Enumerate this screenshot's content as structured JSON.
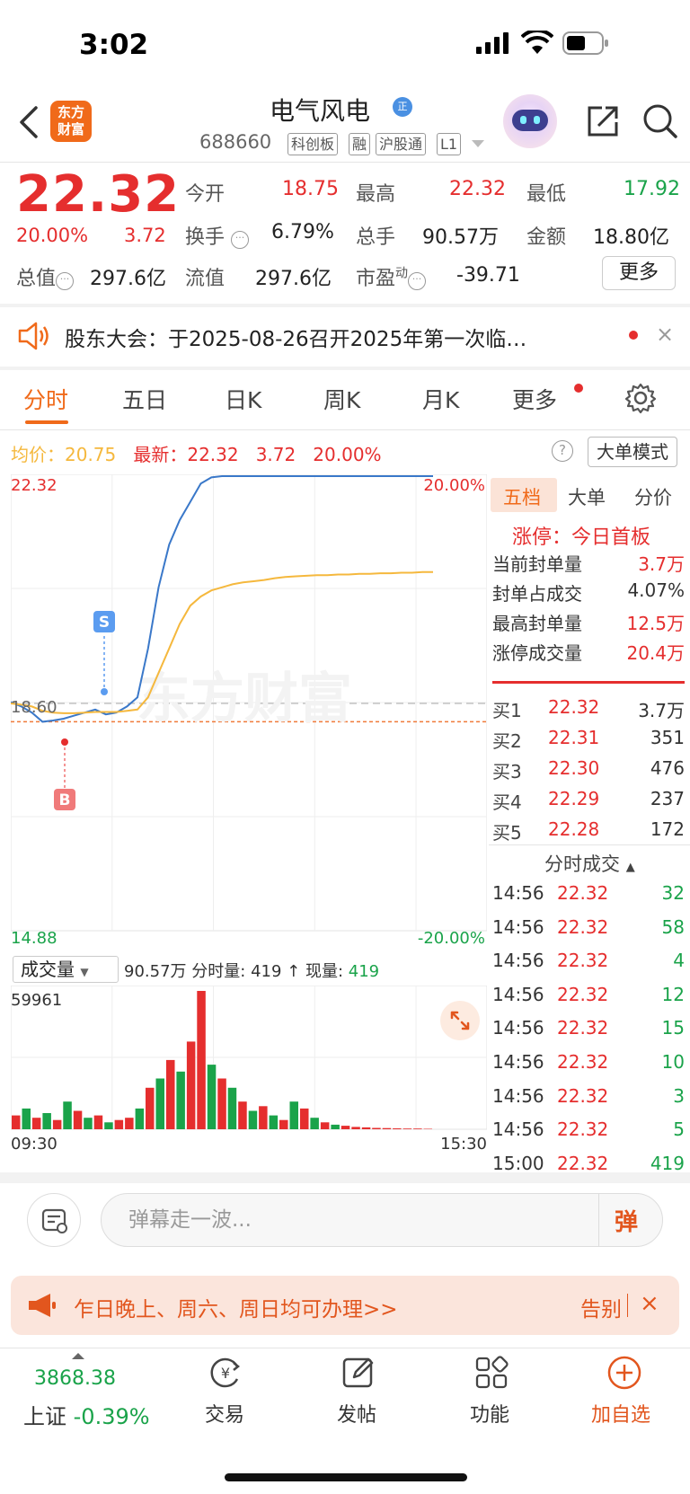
{
  "status": {
    "time": "3:02"
  },
  "header": {
    "logo": "东方\n财富",
    "name": "电气风电",
    "name_badge": "正",
    "code": "688660",
    "tags": [
      "科创板",
      "融",
      "沪股通",
      "L1"
    ]
  },
  "quote": {
    "price": "22.32",
    "pct": "20.00%",
    "chg": "3.72",
    "open_label": "今开",
    "open": "18.75",
    "high_label": "最高",
    "high": "22.32",
    "low_label": "最低",
    "low": "17.92",
    "turnover_label": "换手",
    "turnover": "6.79%",
    "volume_label": "总手",
    "volume": "90.57万",
    "amount_label": "金额",
    "amount": "18.80亿",
    "mktcap_label": "总值",
    "mktcap": "297.6亿",
    "float_label": "流值",
    "float": "297.6亿",
    "pe_label": "市盈",
    "pe_sup": "动",
    "pe": "-39.71",
    "more": "更多"
  },
  "notice": {
    "text": "股东大会：于2025-08-26召开2025年第一次临…",
    "close": "×"
  },
  "tabs": [
    "分时",
    "五日",
    "日K",
    "周K",
    "月K",
    "更多"
  ],
  "chart_header": {
    "avg_label": "均价：",
    "avg": "20.75",
    "latest_label": "最新：",
    "latest": "22.32",
    "chg": "3.72",
    "pct": "20.00%",
    "help": "?",
    "big_order": "大单模式"
  },
  "chart_labels": {
    "top_price": "22.32",
    "top_pct": "20.00%",
    "mid_price": "18.60",
    "bottom_price": "14.88",
    "bottom_pct": "-20.00%",
    "marker_s": "S",
    "marker_b": "B",
    "watermark": "东方财富"
  },
  "chart_data": {
    "type": "line",
    "ylim": [
      14.88,
      22.32
    ],
    "prev_close": 18.6,
    "series": [
      {
        "name": "price",
        "values": [
          18.62,
          18.55,
          18.45,
          18.3,
          18.32,
          18.35,
          18.4,
          18.45,
          18.5,
          18.42,
          18.45,
          18.55,
          18.7,
          19.5,
          20.5,
          21.2,
          21.6,
          21.9,
          22.2,
          22.3,
          22.32,
          22.32,
          22.32,
          22.32,
          22.32,
          22.32,
          22.32,
          22.32,
          22.32,
          22.32,
          22.32,
          22.32,
          22.32,
          22.32,
          22.32,
          22.32,
          22.32,
          22.32,
          22.32,
          22.32,
          22.32
        ]
      },
      {
        "name": "avg",
        "values": [
          18.6,
          18.58,
          18.55,
          18.48,
          18.45,
          18.44,
          18.44,
          18.45,
          18.46,
          18.46,
          18.46,
          18.48,
          18.5,
          18.7,
          19.1,
          19.5,
          19.9,
          20.2,
          20.35,
          20.45,
          20.5,
          20.55,
          20.58,
          20.6,
          20.62,
          20.65,
          20.67,
          20.68,
          20.69,
          20.7,
          20.7,
          20.71,
          20.71,
          20.72,
          20.72,
          20.73,
          20.73,
          20.74,
          20.74,
          20.75,
          20.75
        ]
      }
    ],
    "volume": {
      "max": 59961,
      "values": [
        6000,
        9000,
        5000,
        7000,
        4000,
        12000,
        8000,
        5000,
        6000,
        3000,
        4000,
        5000,
        9000,
        18000,
        22000,
        30000,
        25000,
        38000,
        59961,
        28000,
        22000,
        18000,
        12000,
        8000,
        10000,
        6000,
        4000,
        12000,
        9000,
        5000,
        3000,
        2000,
        1500,
        1000,
        800,
        600,
        500,
        400,
        300,
        300,
        200
      ],
      "colors": [
        "r",
        "g",
        "r",
        "g",
        "r",
        "g",
        "r",
        "g",
        "r",
        "g",
        "r",
        "r",
        "g",
        "r",
        "g",
        "r",
        "g",
        "r",
        "r",
        "g",
        "r",
        "g",
        "r",
        "g",
        "r",
        "g",
        "r",
        "g",
        "r",
        "g",
        "r",
        "g",
        "r",
        "r",
        "r",
        "r",
        "r",
        "r",
        "r",
        "r",
        "r"
      ]
    },
    "x_labels": [
      "09:30",
      "15:30"
    ]
  },
  "volume_bar": {
    "select": "成交量",
    "total": "90.57万",
    "tick_label": "分时量:",
    "tick": "419",
    "now_label": "现量:",
    "now": "419",
    "max": "59961"
  },
  "right_panel": {
    "tabs": [
      "五档",
      "大单",
      "分价"
    ],
    "limit_title": "涨停：今日首板",
    "stats": [
      {
        "label": "当前封单量",
        "value": "3.7万"
      },
      {
        "label": "封单占成交",
        "value": "4.07%"
      },
      {
        "label": "最高封单量",
        "value": "12.5万"
      },
      {
        "label": "涨停成交量",
        "value": "20.4万"
      }
    ],
    "bids": [
      {
        "label": "买1",
        "price": "22.32",
        "vol": "3.7万"
      },
      {
        "label": "买2",
        "price": "22.31",
        "vol": "351"
      },
      {
        "label": "买3",
        "price": "22.30",
        "vol": "476"
      },
      {
        "label": "买4",
        "price": "22.29",
        "vol": "237"
      },
      {
        "label": "买5",
        "price": "22.28",
        "vol": "172"
      }
    ],
    "ticks_title": "分时成交",
    "ticks": [
      {
        "time": "14:56",
        "price": "22.32",
        "vol": "32"
      },
      {
        "time": "14:56",
        "price": "22.32",
        "vol": "58"
      },
      {
        "time": "14:56",
        "price": "22.32",
        "vol": "4"
      },
      {
        "time": "14:56",
        "price": "22.32",
        "vol": "12"
      },
      {
        "time": "14:56",
        "price": "22.32",
        "vol": "15"
      },
      {
        "time": "14:56",
        "price": "22.32",
        "vol": "10"
      },
      {
        "time": "14:56",
        "price": "22.32",
        "vol": "3"
      },
      {
        "time": "14:56",
        "price": "22.32",
        "vol": "5"
      },
      {
        "time": "15:00",
        "price": "22.32",
        "vol": "419"
      }
    ]
  },
  "danmu": {
    "placeholder": "弹幕走一波...",
    "button": "弹"
  },
  "promo": {
    "text": "乍日晚上、周六、周日均可办理>>",
    "right": "告别",
    "close": "×"
  },
  "bottom_nav": {
    "index_value": "3868.38",
    "index_name": "上证",
    "index_pct": "-0.39%",
    "items": [
      "交易",
      "发帖",
      "功能",
      "加自选"
    ]
  },
  "colors": {
    "up": "#e52e2e",
    "down": "#1aa34a",
    "accent": "#f06a1a",
    "price_line": "#3a78c9",
    "avg_line": "#f5b83d"
  }
}
